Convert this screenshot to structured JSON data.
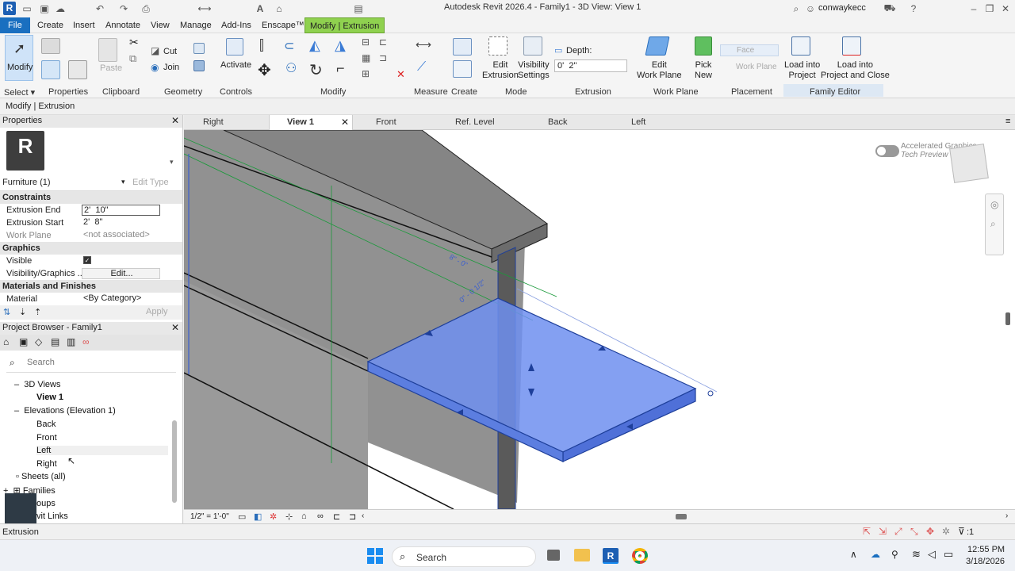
{
  "app": {
    "title": "Autodesk Revit 2026.4 - Family1 - 3D View: View 1",
    "user": "conwaykecc"
  },
  "menu": [
    "File",
    "Create",
    "Insert",
    "Annotate",
    "View",
    "Manage",
    "Add-Ins",
    "Enscape™",
    "Modify | Extrusion"
  ],
  "ribbon": {
    "modify": "Modify",
    "cut": "Cut",
    "join": "Join",
    "activate": "Activate",
    "paste": "Paste",
    "edit_extrusion": "Edit\nExtrusion",
    "visibility_settings": "Visibility\nSettings",
    "depth_label": "Depth:",
    "depth_value": "0'  2\"",
    "edit_work_plane": "Edit\nWork Plane",
    "pick_new": "Pick\nNew",
    "face": "Face",
    "work_plane": "Work Plane",
    "load_into_project": "Load into\nProject",
    "load_into_project_close": "Load into\nProject and Close",
    "panels": [
      "Select ▾",
      "Properties",
      "Clipboard",
      "Geometry",
      "Controls",
      "Modify",
      "Measure",
      "Create",
      "Mode",
      "Extrusion",
      "Work Plane",
      "Placement",
      "Family Editor"
    ]
  },
  "context": "Modify | Extrusion",
  "properties": {
    "header": "Properties",
    "type_selector": "Furniture (1)",
    "edit_type": "Edit Type",
    "sections": {
      "constraints": "Constraints",
      "graphics": "Graphics",
      "materials": "Materials and Finishes"
    },
    "rows": {
      "extrusion_end_k": "Extrusion End",
      "extrusion_end_v": "2'  10\"",
      "extrusion_start_k": "Extrusion Start",
      "extrusion_start_v": "2'  8\"",
      "work_plane_k": "Work Plane",
      "work_plane_v": "<not associated>",
      "visible_k": "Visible",
      "visgraphics_k": "Visibility/Graphics ...",
      "visgraphics_v": "Edit...",
      "material_k": "Material",
      "material_v": "<By Category>"
    },
    "apply": "Apply"
  },
  "browser": {
    "header": "Project Browser - Family1",
    "search": "Search",
    "items": {
      "views3d": "3D Views",
      "view1": "View 1",
      "elevations": "Elevations (Elevation 1)",
      "back": "Back",
      "front": "Front",
      "left": "Left",
      "right": "Right",
      "sheets": "Sheets (all)",
      "families": "Families",
      "groups": "oups",
      "links": "vit Links"
    }
  },
  "tabs": [
    "Right",
    "View 1",
    "Front",
    "Ref. Level",
    "Back",
    "Left"
  ],
  "canvas": {
    "accel_label": "Accelerated Graphics",
    "accel_sub": "Tech Preview",
    "dim1": "8\" - 0\"",
    "dim2": "0\" - 0 1/2\""
  },
  "viewbar": {
    "scale": "1/2\" = 1'-0\""
  },
  "status": {
    "text": "Extrusion",
    "filter_count": ":1"
  },
  "taskbar": {
    "search": "Search",
    "time": "12:55 PM",
    "date": "3/18/2026"
  },
  "colors": {
    "accent": "#1a6fc0",
    "context_tab": "#8fd14f",
    "selection": "#6f8ff0"
  }
}
